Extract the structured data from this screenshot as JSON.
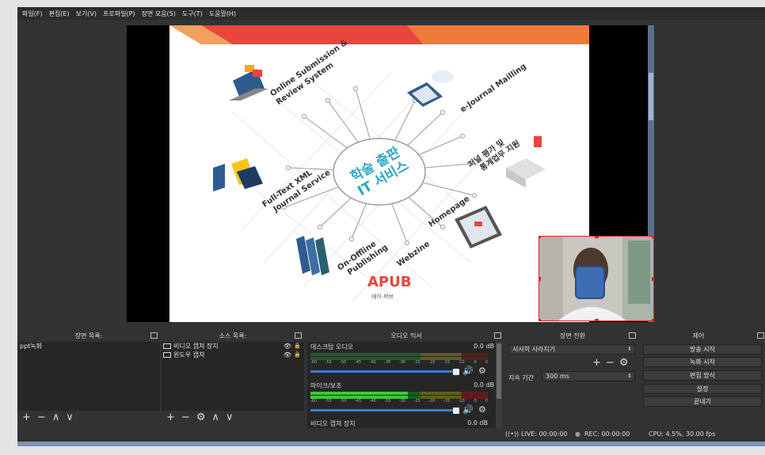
{
  "menu": [
    "파일(F)",
    "편집(E)",
    "보기(V)",
    "프로파일(P)",
    "장면 모음(S)",
    "도구(T)",
    "도움말(H)"
  ],
  "slide": {
    "hub_title_line1": "학술 출판",
    "hub_title_line2": "IT 서비스",
    "items": [
      {
        "line1": "Online Submission &",
        "line2": "Review System"
      },
      {
        "line1": "e-Journal Mailling",
        "line2": ""
      },
      {
        "line1": "저널 평가 및",
        "line2": "통계업무 지원"
      },
      {
        "line1": "Full-Text XML",
        "line2": "Journal Service"
      },
      {
        "line1": "On-Offline",
        "line2": "Publishing"
      },
      {
        "line1": "Homepage",
        "line2": ""
      },
      {
        "line1": "Webzine",
        "line2": ""
      }
    ],
    "logo_sub": "에이·퍼브"
  },
  "docks": {
    "scenes": {
      "title": "장면 목록:",
      "items": [
        "ppt녹화"
      ]
    },
    "sources": {
      "title": "소스 목록:",
      "items": [
        "비디오 캡쳐 장치",
        "윈도우 캡쳐"
      ]
    },
    "mixer": {
      "title": "오디오 믹서",
      "tracks": [
        {
          "name": "데스크탑 오디오",
          "db": "0.0 dB"
        },
        {
          "name": "마이크/보조",
          "db": "0.0 dB"
        },
        {
          "name": "비디오 캡쳐 장치",
          "db": "0.0 dB"
        }
      ],
      "tick_labels": [
        "-60",
        "-55",
        "-50",
        "-45",
        "-40",
        "-35",
        "-30",
        "-25",
        "-20",
        "-15",
        "-10",
        "-5",
        "0"
      ]
    },
    "transitions": {
      "title": "장면 전환",
      "selected": "서서히 사라지기",
      "duration_label": "지속 기간",
      "duration_value": "300 ms"
    },
    "controls": {
      "title": "제어",
      "buttons": [
        "방송 시작",
        "녹화 시작",
        "편집 방식",
        "설정",
        "끝내기"
      ]
    }
  },
  "status": {
    "live": "LIVE: 00:00:00",
    "rec": "REC: 00:00:00",
    "cpu": "CPU: 4.5%, 30.00 fps"
  },
  "colors": {
    "accent_red": "#e8453c",
    "hub_blue": "#2aa7c8"
  }
}
